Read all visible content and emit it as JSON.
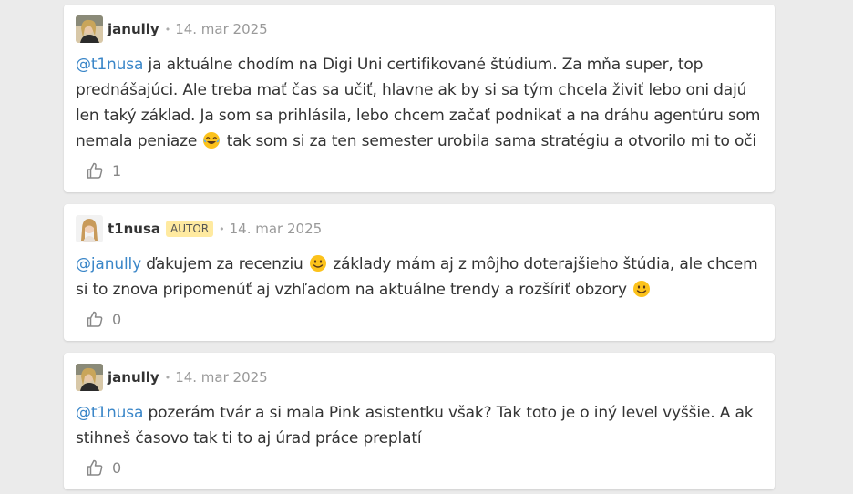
{
  "comments": [
    {
      "author": "janully",
      "date": "14. mar 2025",
      "badge": null,
      "mention": "@t1nusa",
      "text_1": " ja aktuálne chodím na Digi Uni certifikované štúdium. Za mňa super, top prednášajúci. Ale treba mať čas sa učiť, hlavne ak by si sa tým chcela živiť lebo oni dajú len taký základ. Ja som sa prihlásila, lebo chcem začať podnikať a na dráhu agentúru som nemala peniaze ",
      "emoji_1": "joy-emoji",
      "text_2": " tak som si za ten semester urobila sama stratégiu a otvorilo mi to oči",
      "likes": "1"
    },
    {
      "author": "t1nusa",
      "date": "14. mar 2025",
      "badge": "AUTOR",
      "mention": "@janully",
      "text_1": " ďakujem za recenziu ",
      "emoji_1": "smile-emoji",
      "text_2": " základy mám aj z môjho doterajšieho štúdia, ale chcem si to znova pripomenúť aj vzhľadom na aktuálne trendy a rozšíriť obzory ",
      "emoji_2": "smile-emoji",
      "likes": "0"
    },
    {
      "author": "janully",
      "date": "14. mar 2025",
      "badge": null,
      "mention": "@t1nusa",
      "text_1": " pozerám tvár a si mala Pink asistentku však? Tak toto je o iný level vyššie. A ak stihneš časovo tak ti to aj úrad práce preplatí",
      "likes": "0"
    }
  ],
  "separator": "•",
  "icons": {
    "like": "thumbs-up-icon"
  },
  "colors": {
    "mention": "#3a86c8",
    "badge_bg": "#ffeaa0",
    "background": "#ebebeb",
    "card": "#ffffff"
  }
}
